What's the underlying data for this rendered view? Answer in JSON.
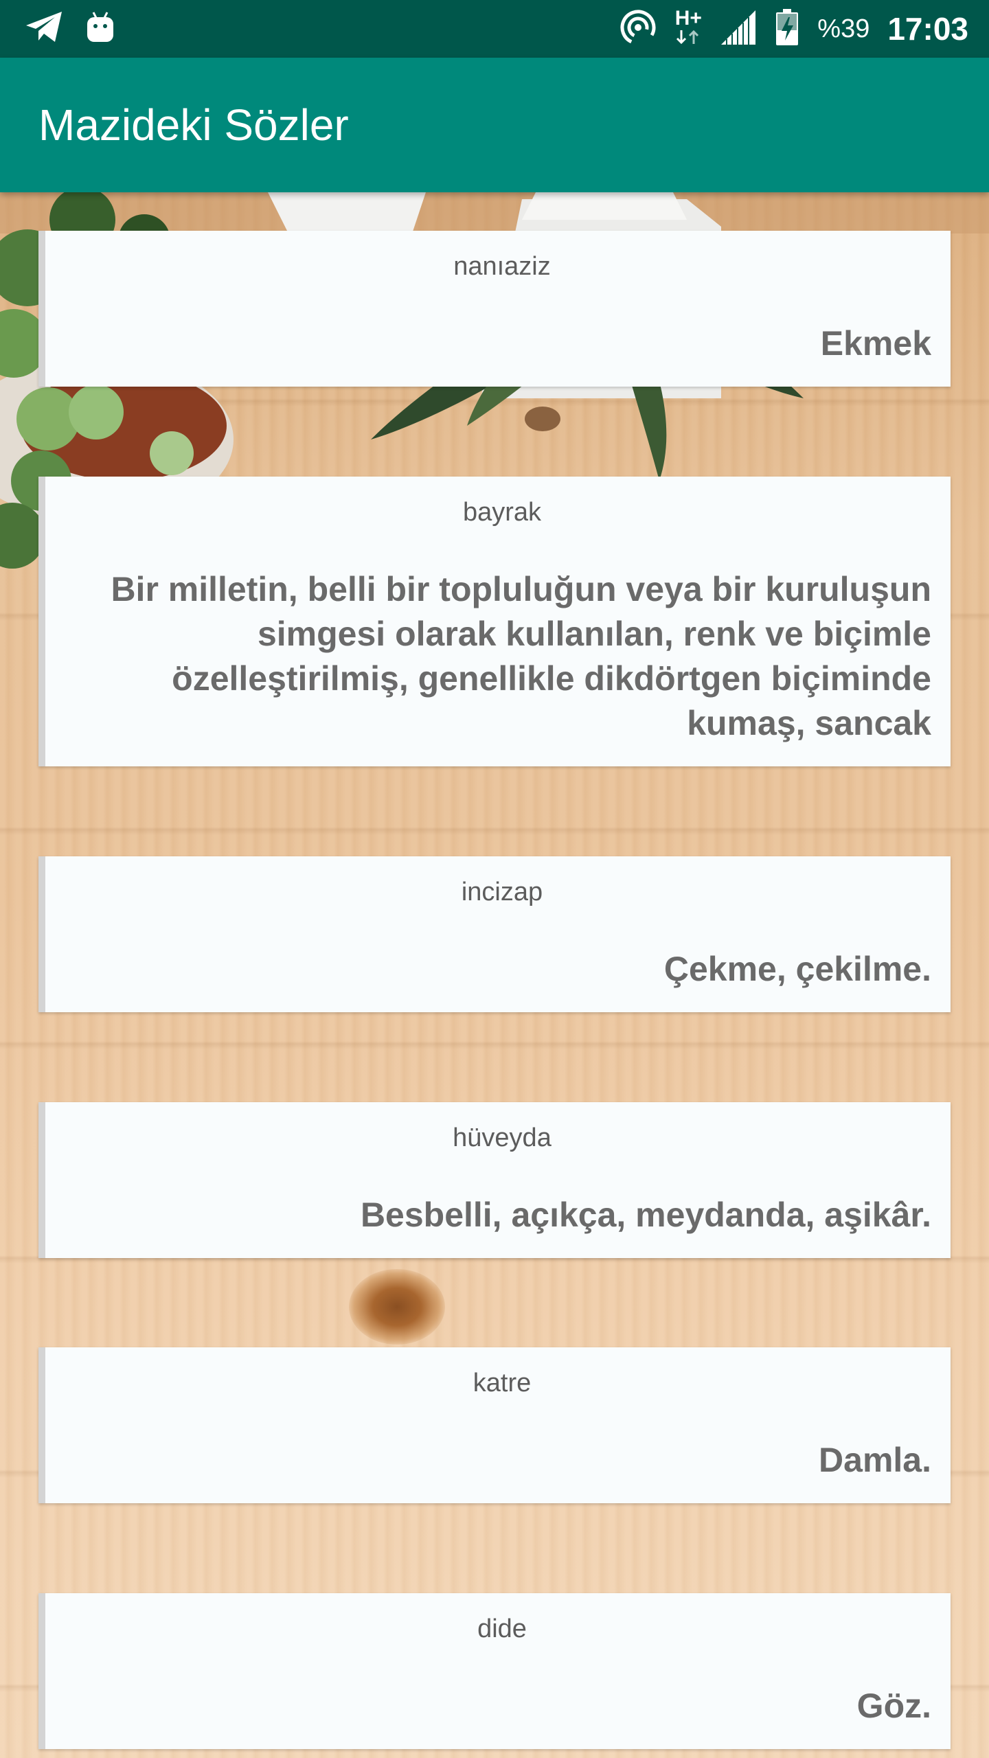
{
  "status_bar": {
    "left_icons": [
      "telegram-icon",
      "android-icon"
    ],
    "right_icons": [
      "hotspot-icon",
      "network-h-plus-icon",
      "signal-icon",
      "battery-charging-icon"
    ],
    "network_label": "H+",
    "battery_percent": "%39",
    "time": "17:03"
  },
  "app_bar": {
    "title": "Mazideki Sözler"
  },
  "colors": {
    "status_bar": "#00574b",
    "app_bar": "#00897b",
    "card_bg": "#f9fcfd",
    "meaning_text": "#6a6a6a",
    "word_text": "#5c5c5c"
  },
  "entries": [
    {
      "word": "nanıaziz",
      "meaning": "Ekmek"
    },
    {
      "word": "bayrak",
      "meaning": "Bir milletin, belli bir topluluğun veya bir kuruluşun simgesi olarak kullanılan, renk ve biçimle özelleştirilmiş, genellikle dikdörtgen biçiminde kumaş, sancak"
    },
    {
      "word": "incizap",
      "meaning": "Çekme, çekilme."
    },
    {
      "word": "hüveyda",
      "meaning": "Besbelli, açıkça, meydanda, aşikâr."
    },
    {
      "word": "katre",
      "meaning": "Damla."
    },
    {
      "word": "dide",
      "meaning": "Göz."
    }
  ]
}
